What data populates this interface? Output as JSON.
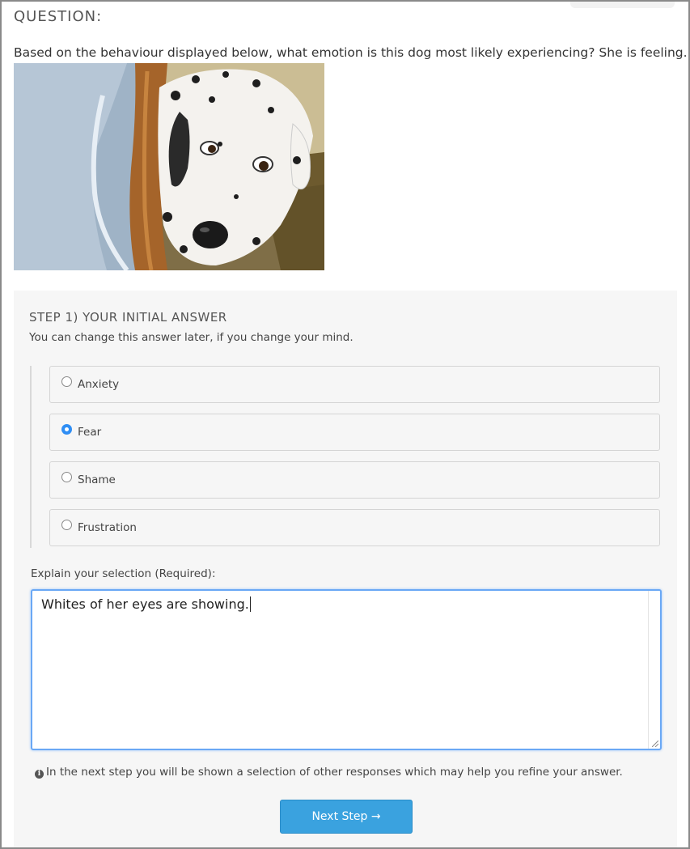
{
  "question": {
    "heading": "QUESTION:",
    "text": "Based on the behaviour displayed below, what emotion is this dog most likely experiencing? She is feeling..."
  },
  "step": {
    "title": "STEP 1) YOUR INITIAL ANSWER",
    "subtitle": "You can change this answer later, if you change your mind."
  },
  "options": [
    {
      "label": "Anxiety",
      "selected": false
    },
    {
      "label": "Fear",
      "selected": true
    },
    {
      "label": "Shame",
      "selected": false
    },
    {
      "label": "Frustration",
      "selected": false
    }
  ],
  "explain": {
    "label": "Explain your selection (Required):",
    "value": "Whites of her eyes are showing."
  },
  "info_text": "In the next step you will be shown a selection of other responses which may help you refine your answer.",
  "next_button": {
    "label": "Next Step →"
  },
  "colors": {
    "accent": "#2f8ef4",
    "button": "#3aa2df",
    "focus_border": "#6aa8f5",
    "panel_bg": "#f6f6f6"
  }
}
